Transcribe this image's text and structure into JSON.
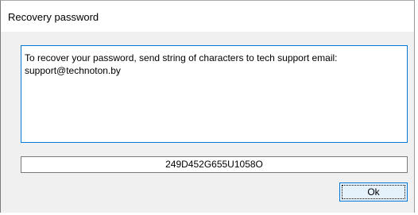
{
  "dialog": {
    "title": "Recovery password",
    "message": "To recover your password, send string of characters to tech support email:\nsupport@technoton.by",
    "code": "249D452G655U1058O",
    "ok_label": "Ok"
  },
  "colors": {
    "accent": "#0078d7",
    "dialog_background": "#f0f0f0",
    "button_background": "#e5f1fb"
  }
}
